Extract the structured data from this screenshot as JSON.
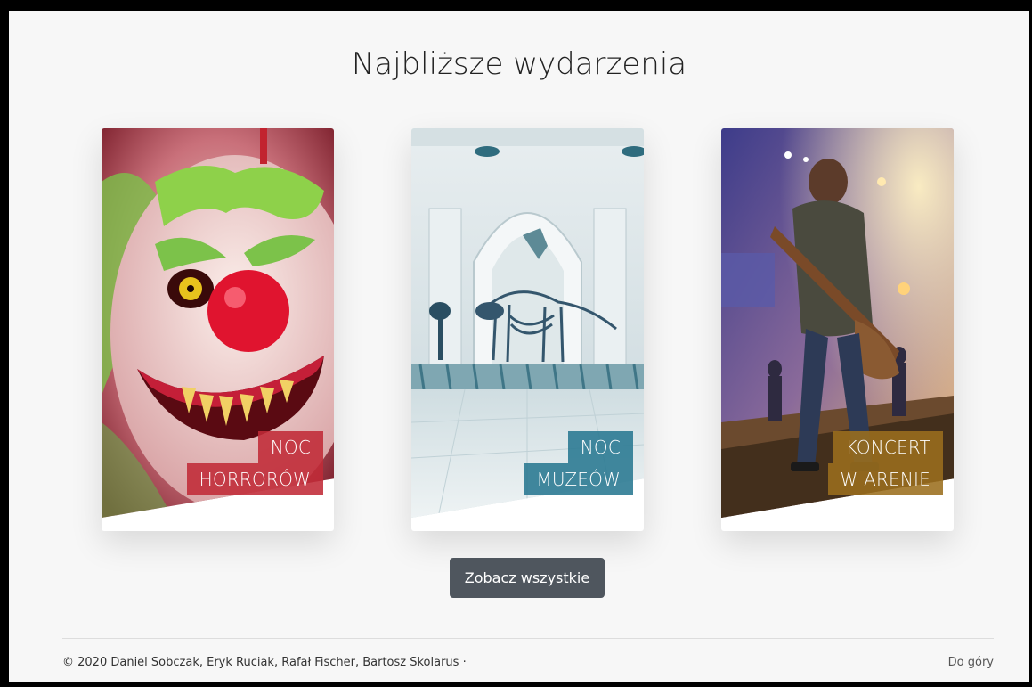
{
  "page": {
    "title": "Najbliższe wydarzenia"
  },
  "events": [
    {
      "line1": "NOC",
      "line2": "HORRORÓW",
      "accent": "#c02a37"
    },
    {
      "line1": "NOC",
      "line2": "MUZEÓW",
      "accent": "#287891"
    },
    {
      "line1": "KONCERT",
      "line2": "W ARENIE",
      "accent": "#9b6e1e"
    }
  ],
  "actions": {
    "see_all": "Zobacz wszystkie"
  },
  "footer": {
    "copyright": "© 2020 Daniel Sobczak, Eryk Ruciak, Rafał Fischer, Bartosz Skolarus ·",
    "back_to_top": "Do góry"
  }
}
